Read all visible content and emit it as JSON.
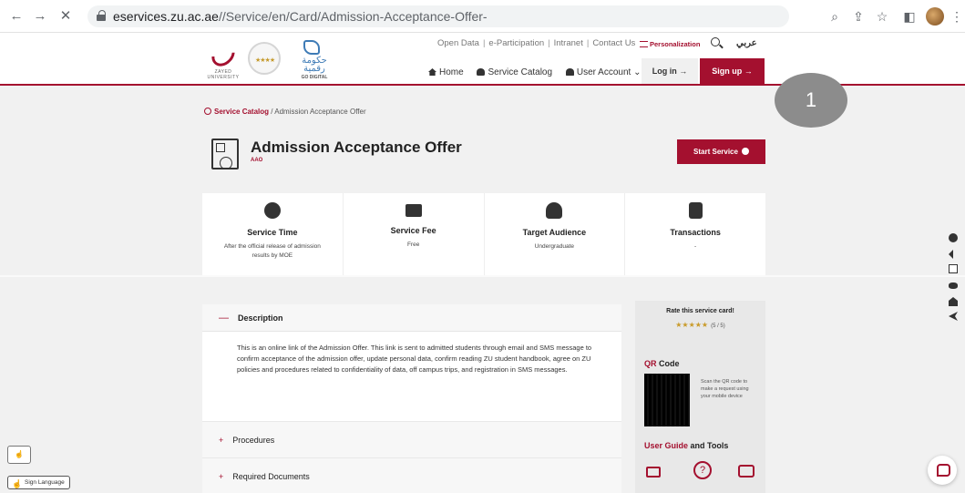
{
  "browser": {
    "url_host": "eservices.zu.ac.ae",
    "url_path": "//Service/en/Card/Admission-Acceptance-Offer-"
  },
  "header": {
    "top_links": [
      "Open Data",
      "e-Participation",
      "Intranet",
      "Contact Us"
    ],
    "personalization": "Personalization",
    "arabic_label": "عربي",
    "nav": {
      "home": "Home",
      "catalog": "Service Catalog",
      "account": "User Account"
    },
    "login": "Log in →",
    "signup": "Sign up →",
    "logo_zu_text": "ZAYED UNIVERSITY",
    "logo_gd_ar": "حكومة رقمية",
    "logo_gd_en": "GO DIGITAL"
  },
  "overlay_badge": "1",
  "breadcrumb": {
    "link": "Service Catalog",
    "current": "Admission Acceptance Offer"
  },
  "service": {
    "title": "Admission Acceptance Offer",
    "code": "AAO",
    "start_button": "Start Service"
  },
  "stats": [
    {
      "label": "Service Time",
      "value": "After the official release of admission results by MOE",
      "icon": "clock-icon"
    },
    {
      "label": "Service Fee",
      "value": "Free",
      "icon": "money-icon"
    },
    {
      "label": "Target Audience",
      "value": "Undergraduate",
      "icon": "users-icon"
    },
    {
      "label": "Transactions",
      "value": "-",
      "icon": "clipboard-chart-icon"
    }
  ],
  "accordion": {
    "description_title": "Description",
    "description_body": "This is an online link of the Admission Offer. This link is sent to admitted students through email and SMS message to confirm acceptance of the admission offer, update personal data, confirm reading ZU student handbook, agree on ZU policies and procedures related to confidentiality of data, off campus trips, and registration in SMS messages.",
    "procedures": "Procedures",
    "required_documents": "Required Documents"
  },
  "side": {
    "rate_title": "Rate this service card!",
    "rate_stars": "★★★★★",
    "rate_score": "(5 / 5)",
    "qr_title_1": "QR",
    "qr_title_2": " Code",
    "qr_desc": "Scan the QR code to make a request using your mobile device",
    "guide_title_1": "User Guide",
    "guide_title_2": " and Tools"
  },
  "sign_language": "Sign Language"
}
